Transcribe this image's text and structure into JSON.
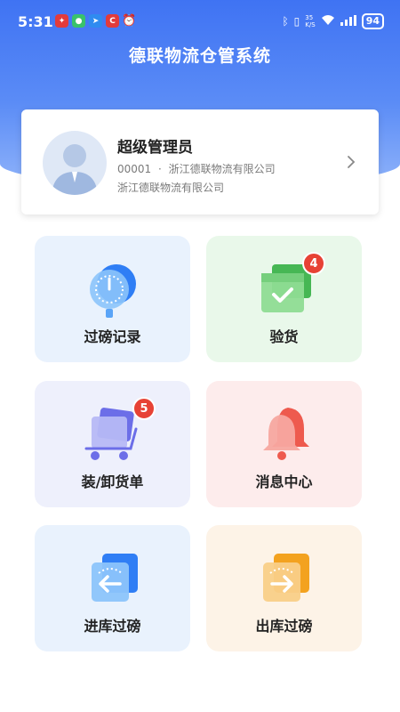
{
  "status_bar": {
    "time": "5:31",
    "network_speed_top": "35",
    "network_speed_bottom": "K/S",
    "battery": "94"
  },
  "app": {
    "title": "德联物流仓管系统"
  },
  "profile": {
    "name": "超级管理员",
    "id": "00001",
    "separator": "·",
    "company_primary": "浙江德联物流有限公司",
    "company_secondary": "浙江德联物流有限公司"
  },
  "menu": [
    {
      "label": "过磅记录",
      "badge": "",
      "icon": "scale-icon"
    },
    {
      "label": "验货",
      "badge": "4",
      "icon": "package-check-icon"
    },
    {
      "label": "装/卸货单",
      "badge": "5",
      "icon": "cart-icon"
    },
    {
      "label": "消息中心",
      "badge": "",
      "icon": "bell-icon"
    },
    {
      "label": "进库过磅",
      "badge": "",
      "icon": "inbound-scale-icon"
    },
    {
      "label": "出库过磅",
      "badge": "",
      "icon": "outbound-scale-icon"
    }
  ],
  "colors": {
    "header": "#3f73f3",
    "tile_blue": "#e9f2fd",
    "tile_green": "#e9f8ea",
    "tile_purple": "#eef0fc",
    "tile_pink": "#fdecec",
    "tile_orange": "#fdf3e7",
    "badge": "#e74235"
  }
}
